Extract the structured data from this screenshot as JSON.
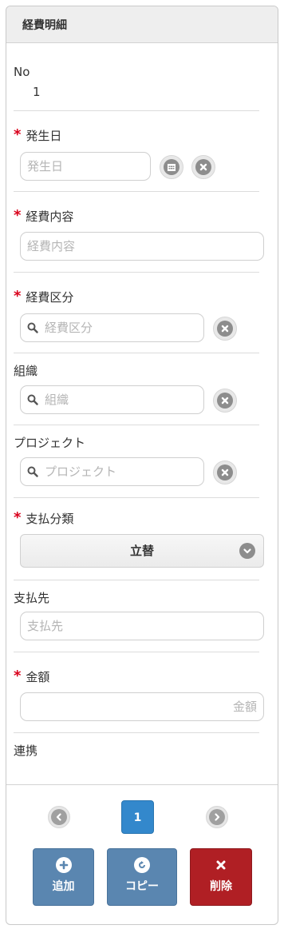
{
  "header": {
    "title": "経費明細"
  },
  "fields": {
    "no": {
      "label": "No",
      "value": "1"
    },
    "date": {
      "label": "発生日",
      "placeholder": "発生日",
      "required": "*"
    },
    "content": {
      "label": "経費内容",
      "placeholder": "経費内容",
      "required": "*"
    },
    "category": {
      "label": "経費区分",
      "placeholder": "経費区分",
      "required": "*"
    },
    "org": {
      "label": "組織",
      "placeholder": "組織"
    },
    "project": {
      "label": "プロジェクト",
      "placeholder": "プロジェクト"
    },
    "payment_type": {
      "label": "支払分類",
      "value": "立替",
      "required": "*"
    },
    "payee": {
      "label": "支払先",
      "placeholder": "支払先"
    },
    "amount": {
      "label": "金額",
      "placeholder": "金額",
      "required": "*"
    },
    "link": {
      "label": "連携"
    }
  },
  "pager": {
    "current": "1"
  },
  "actions": {
    "add": "追加",
    "copy": "コピー",
    "delete": "削除"
  },
  "colors": {
    "primary": "#3388cc",
    "action": "#5a86b0",
    "danger": "#b01f24",
    "required": "#d9001b"
  }
}
